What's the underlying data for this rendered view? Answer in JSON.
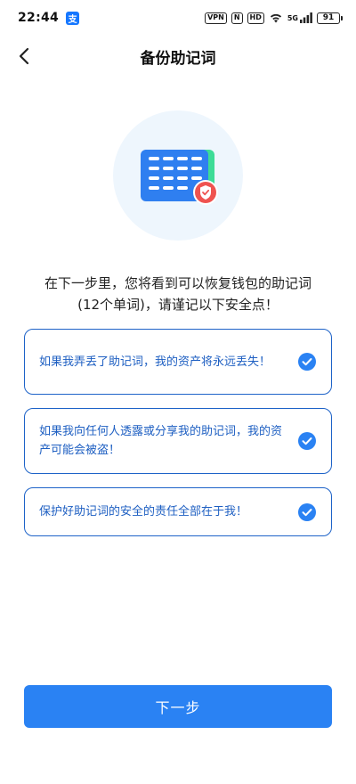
{
  "status_bar": {
    "time": "22:44",
    "app_icon_glyph": "支",
    "vpn": "VPN",
    "nfc": "N",
    "hd": "HD",
    "signal_label": "5G",
    "battery": "91"
  },
  "header": {
    "title": "备份助记词"
  },
  "intro": {
    "line1": "在下一步里，您将看到可以恢复钱包的助记词",
    "line2": "(12个单词)，请谨记以下安全点！"
  },
  "tips": [
    {
      "text": "如果我弄丢了助记词，我的资产将永远丢失！",
      "checked": true
    },
    {
      "text": "如果我向任何人透露或分享我的助记词，我的资产可能会被盗！",
      "checked": true
    },
    {
      "text": "保护好助记词的安全的责任全部在于我！",
      "checked": true
    }
  ],
  "footer": {
    "next_label": "下一步"
  },
  "colors": {
    "accent": "#2a82f3",
    "card_border": "#1e63c8",
    "tip_text": "#1e5fc2",
    "illustration_bg": "#eef6fd",
    "shield": "#ef5350"
  }
}
